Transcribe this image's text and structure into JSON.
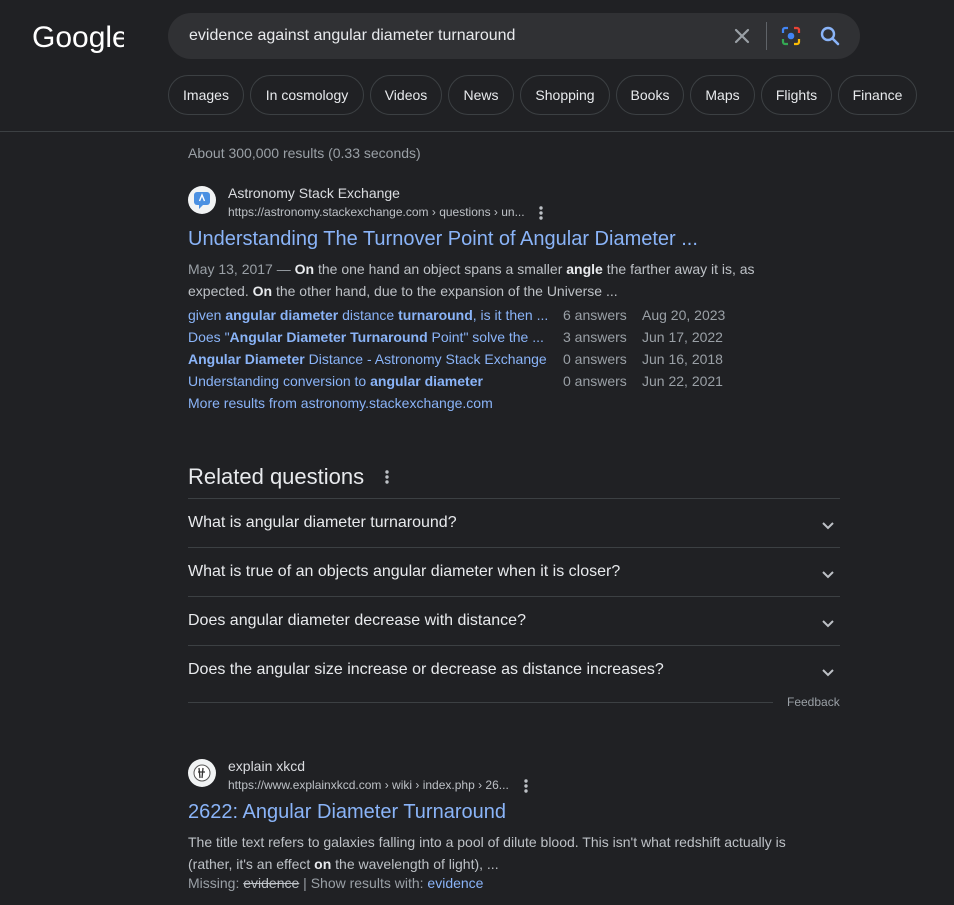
{
  "logo": "Google",
  "search": {
    "query": "evidence against angular diameter turnaround",
    "clear_icon": "close-icon",
    "lens_icon": "lens-icon",
    "search_icon": "search-icon"
  },
  "chips": [
    "Images",
    "In cosmology",
    "Videos",
    "News",
    "Shopping",
    "Books",
    "Maps",
    "Flights",
    "Finance"
  ],
  "stats": "About 300,000 results (0.33 seconds)",
  "results": [
    {
      "site_name": "Astronomy Stack Exchange",
      "url": "https://astronomy.stackexchange.com › questions › un...",
      "title": "Understanding The Turnover Point of Angular Diameter ...",
      "date": "May 13, 2017",
      "date_sep": " — ",
      "snippet": {
        "b1": "On",
        "t1": " the one hand an object spans a smaller ",
        "b2": "angle",
        "t2": " the farther away it is, as expected. ",
        "b3": "On",
        "t3": " the other hand, due to the expansion of the Universe ..."
      },
      "sitelinks": [
        {
          "t1": "given ",
          "b1": "angular diameter",
          "t2": " distance ",
          "b2": "turnaround",
          "t3": ", is it then ...",
          "answers": "6 answers",
          "date": "Aug 20, 2023"
        },
        {
          "t1": "Does \"",
          "b1": "Angular Diameter Turnaround",
          "t2": " Point\" solve the ...",
          "b2": "",
          "t3": "",
          "answers": "3 answers",
          "date": "Jun 17, 2022"
        },
        {
          "t1": "",
          "b1": "Angular Diameter",
          "t2": " Distance - Astronomy Stack Exchange",
          "b2": "",
          "t3": "",
          "answers": "0 answers",
          "date": "Jun 16, 2018"
        },
        {
          "t1": "Understanding conversion to ",
          "b1": "angular diameter",
          "t2": "",
          "b2": "",
          "t3": "",
          "answers": "0 answers",
          "date": "Jun 22, 2021"
        }
      ],
      "more_results": "More results from astronomy.stackexchange.com"
    },
    {
      "site_name": "explain xkcd",
      "url": "https://www.explainxkcd.com › wiki › index.php › 26...",
      "title": "2622: Angular Diameter Turnaround",
      "snippet": {
        "t1": "The title text refers to galaxies falling into a pool of dilute blood. This isn't what redshift actually is (rather, it's an effect ",
        "b1": "on",
        "t2": " the wavelength of light), ..."
      },
      "missing_label": "Missing: ",
      "missing_term": "evidence",
      "show_with": " | Show results with: ",
      "show_term": "evidence"
    }
  ],
  "related": {
    "title": "Related questions",
    "questions": [
      "What is angular diameter turnaround?",
      "What is true of an objects angular diameter when it is closer?",
      "Does angular diameter decrease with distance?",
      "Does the angular size increase or decrease as distance increases?"
    ],
    "feedback": "Feedback"
  },
  "colors": {
    "background": "#202124",
    "link": "#8ab4f8",
    "text": "#bdc1c6"
  }
}
